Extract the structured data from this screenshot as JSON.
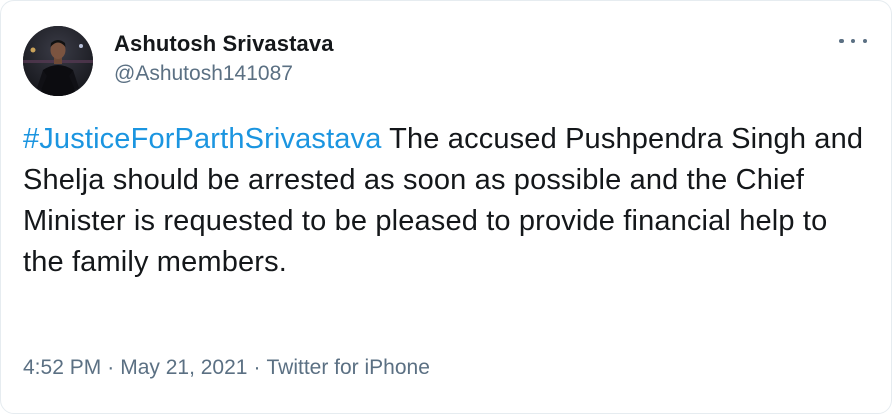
{
  "author": {
    "display_name": "Ashutosh Srivastava",
    "handle": "@Ashutosh141087"
  },
  "tweet": {
    "hashtag": "#JusticeForParthSrivastava",
    "text": " The accused Pushpendra Singh and Shelja should be arrested as soon as possible and the Chief Minister is requested to be pleased to provide financial help to the family members.",
    "time": "4:52 PM",
    "separator": "·",
    "date": "May 21, 2021",
    "source": "Twitter for iPhone"
  },
  "icons": {
    "more": "more-horizontal-icon"
  },
  "colors": {
    "text": "#14171a",
    "secondary": "#5b7083",
    "link": "#1b95e0",
    "border": "#e6ecf0"
  }
}
